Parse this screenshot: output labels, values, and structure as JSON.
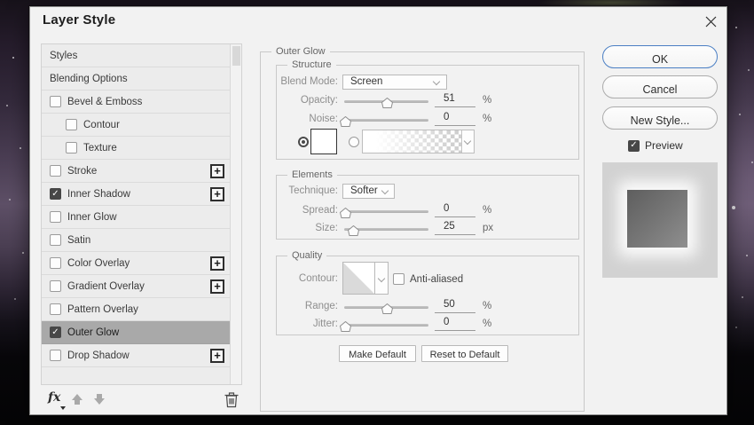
{
  "window": {
    "title": "Layer Style"
  },
  "icons": {
    "check": "✓",
    "plus": "+",
    "fx": "fx"
  },
  "sidebar": {
    "items": [
      {
        "label": "Styles",
        "checkbox": "none",
        "indent": false,
        "plus": false,
        "selected": false
      },
      {
        "label": "Blending Options",
        "checkbox": "none",
        "indent": false,
        "plus": false,
        "selected": false
      },
      {
        "label": "Bevel & Emboss",
        "checkbox": "unchecked",
        "indent": false,
        "plus": false,
        "selected": false
      },
      {
        "label": "Contour",
        "checkbox": "unchecked",
        "indent": true,
        "plus": false,
        "selected": false
      },
      {
        "label": "Texture",
        "checkbox": "unchecked",
        "indent": true,
        "plus": false,
        "selected": false
      },
      {
        "label": "Stroke",
        "checkbox": "unchecked",
        "indent": false,
        "plus": true,
        "selected": false
      },
      {
        "label": "Inner Shadow",
        "checkbox": "checked",
        "indent": false,
        "plus": true,
        "selected": false
      },
      {
        "label": "Inner Glow",
        "checkbox": "unchecked",
        "indent": false,
        "plus": false,
        "selected": false
      },
      {
        "label": "Satin",
        "checkbox": "unchecked",
        "indent": false,
        "plus": false,
        "selected": false
      },
      {
        "label": "Color Overlay",
        "checkbox": "unchecked",
        "indent": false,
        "plus": true,
        "selected": false
      },
      {
        "label": "Gradient Overlay",
        "checkbox": "unchecked",
        "indent": false,
        "plus": true,
        "selected": false
      },
      {
        "label": "Pattern Overlay",
        "checkbox": "unchecked",
        "indent": false,
        "plus": false,
        "selected": false
      },
      {
        "label": "Outer Glow",
        "checkbox": "checked",
        "indent": false,
        "plus": false,
        "selected": true
      },
      {
        "label": "Drop Shadow",
        "checkbox": "unchecked",
        "indent": false,
        "plus": true,
        "selected": false
      }
    ]
  },
  "panel": {
    "group_title": "Outer Glow",
    "structure": {
      "legend": "Structure",
      "blend_mode_label": "Blend Mode:",
      "blend_mode_value": "Screen",
      "opacity_label": "Opacity:",
      "opacity_value": "51",
      "opacity_unit": "%",
      "opacity_pct": 51,
      "noise_label": "Noise:",
      "noise_value": "0",
      "noise_unit": "%",
      "noise_pct": 1
    },
    "elements": {
      "legend": "Elements",
      "technique_label": "Technique:",
      "technique_value": "Softer",
      "spread_label": "Spread:",
      "spread_value": "0",
      "spread_unit": "%",
      "spread_pct": 1,
      "size_label": "Size:",
      "size_value": "25",
      "size_unit": "px",
      "size_pct": 10
    },
    "quality": {
      "legend": "Quality",
      "contour_label": "Contour:",
      "anti_aliased_label": "Anti-aliased",
      "anti_aliased_checked": false,
      "range_label": "Range:",
      "range_value": "50",
      "range_unit": "%",
      "range_pct": 50,
      "jitter_label": "Jitter:",
      "jitter_value": "0",
      "jitter_unit": "%",
      "jitter_pct": 1
    },
    "buttons": {
      "make_default": "Make Default",
      "reset_to_default": "Reset to Default"
    }
  },
  "actions": {
    "ok": "OK",
    "cancel": "Cancel",
    "new_style": "New Style...",
    "preview_label": "Preview",
    "preview_checked": true
  },
  "colors": {
    "dialog_bg": "#f2f2f2",
    "sidebar_selected": "#a9a9a9",
    "ok_border": "#4b7fc4",
    "checkbox_fill": "#474747",
    "preview_bg": "#d2d2d2"
  }
}
